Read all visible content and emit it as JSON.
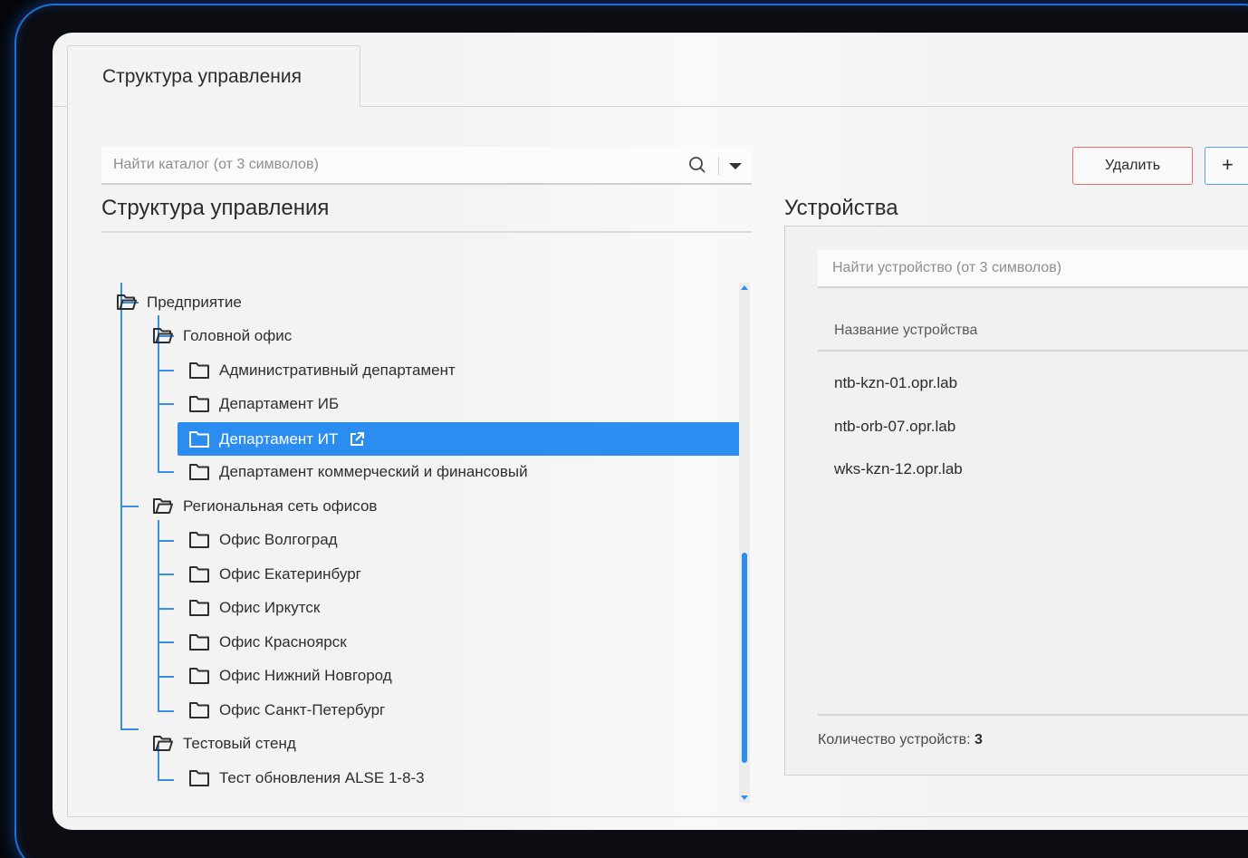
{
  "tab": {
    "label": "Структура управления"
  },
  "catalog_search": {
    "placeholder": "Найти каталог (от 3 символов)"
  },
  "left_panel": {
    "title": "Структура управления"
  },
  "tree": [
    {
      "label": "Предприятие",
      "level": 0,
      "icon": "folder-open-icon"
    },
    {
      "label": "Головной офис",
      "level": 1,
      "icon": "folder-open-icon"
    },
    {
      "label": "Административный департамент",
      "level": 2,
      "icon": "folder-icon"
    },
    {
      "label": "Департамент ИБ",
      "level": 2,
      "icon": "folder-icon"
    },
    {
      "label": "Департамент ИТ",
      "level": 2,
      "icon": "folder-icon",
      "selected": true
    },
    {
      "label": "Департамент коммерческий и финансовый",
      "level": 2,
      "icon": "folder-icon"
    },
    {
      "label": "Региональная сеть офисов",
      "level": 1,
      "icon": "folder-open-icon"
    },
    {
      "label": "Офис Волгоград",
      "level": 2,
      "icon": "folder-icon"
    },
    {
      "label": "Офис Екатеринбург",
      "level": 2,
      "icon": "folder-icon"
    },
    {
      "label": "Офис Иркутск",
      "level": 2,
      "icon": "folder-icon"
    },
    {
      "label": "Офис Красноярск",
      "level": 2,
      "icon": "folder-icon"
    },
    {
      "label": "Офис Нижний Новгород",
      "level": 2,
      "icon": "folder-icon"
    },
    {
      "label": "Офис Санкт-Петербург",
      "level": 2,
      "icon": "folder-icon"
    },
    {
      "label": "Тестовый стенд",
      "level": 1,
      "icon": "folder-open-icon"
    },
    {
      "label": "Тест обновления ALSE 1-8-3",
      "level": 2,
      "icon": "folder-icon"
    }
  ],
  "toolbar": {
    "delete_label": "Удалить",
    "add_label": "+"
  },
  "right_panel": {
    "title": "Устройства",
    "search_placeholder": "Найти устройство (от 3 символов)",
    "column_header": "Название устройства",
    "devices": [
      "ntb-kzn-01.opr.lab",
      "ntb-orb-07.opr.lab",
      "wks-kzn-12.opr.lab"
    ],
    "count_label": "Количество устройств:",
    "count_value": "3"
  },
  "colors": {
    "accent": "#2b8df0",
    "danger_border": "#e3706a",
    "frame_glow": "#1f6fd6"
  }
}
